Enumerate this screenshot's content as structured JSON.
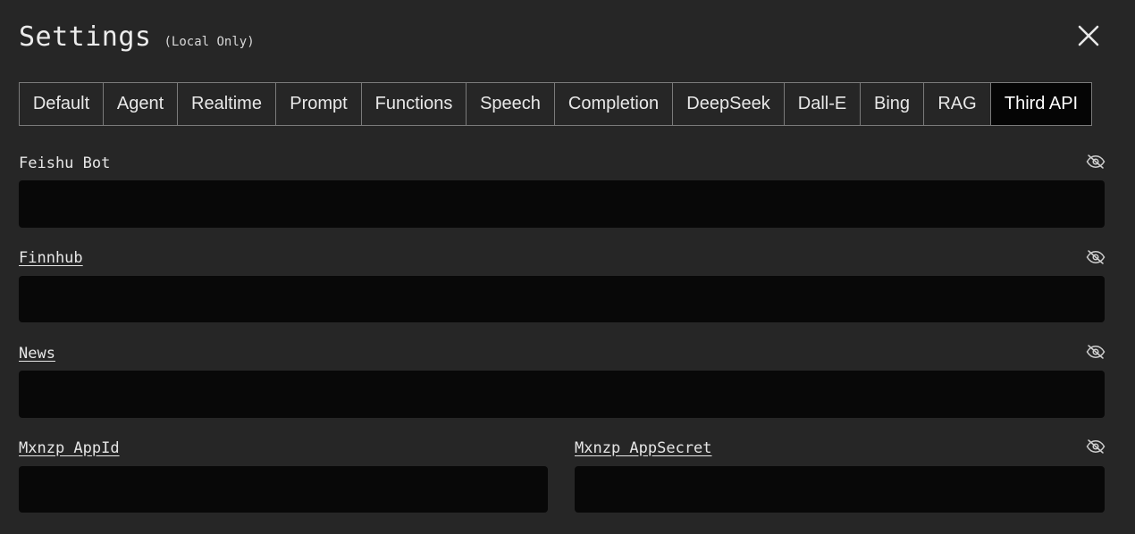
{
  "header": {
    "title": "Settings",
    "subtitle": "(Local Only)"
  },
  "icons": {
    "close": "close-icon",
    "visibility": "eye-off-icon"
  },
  "tabs": [
    {
      "label": "Default",
      "active": false
    },
    {
      "label": "Agent",
      "active": false
    },
    {
      "label": "Realtime",
      "active": false
    },
    {
      "label": "Prompt",
      "active": false
    },
    {
      "label": "Functions",
      "active": false
    },
    {
      "label": "Speech",
      "active": false
    },
    {
      "label": "Completion",
      "active": false
    },
    {
      "label": "DeepSeek",
      "active": false
    },
    {
      "label": "Dall-E",
      "active": false
    },
    {
      "label": "Bing",
      "active": false
    },
    {
      "label": "RAG",
      "active": false
    },
    {
      "label": "Third API",
      "active": true
    }
  ],
  "fields": {
    "feishu_bot": {
      "label": "Feishu Bot",
      "value": ""
    },
    "finnhub": {
      "label": "Finnhub",
      "value": ""
    },
    "news": {
      "label": "News",
      "value": ""
    },
    "mxnzp_appid": {
      "label": "Mxnzp AppId",
      "value": ""
    },
    "mxnzp_appsecret": {
      "label": "Mxnzp AppSecret",
      "value": ""
    }
  },
  "colors": {
    "background": "#262626",
    "input_background": "#080808",
    "active_tab": "#050505",
    "border": "#7a7a7a"
  }
}
